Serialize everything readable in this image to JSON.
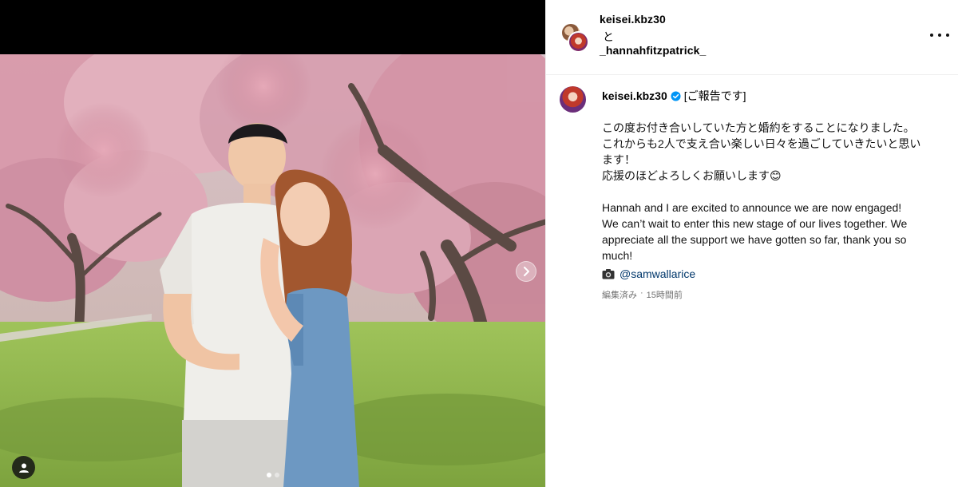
{
  "post": {
    "header": {
      "username": "keisei.kbz30",
      "connector": "と",
      "collaborator": "_hannahfitzpatrick_",
      "more_icon": "more-horizontal-icon"
    },
    "caption": {
      "username": "keisei.kbz30",
      "verified": true,
      "heading": "[ご報告です]",
      "japanese_lines": [
        "この度お付き合いしていた方と婚約をすることになりました。",
        "これからも2人で支え合い楽しい日々を過ごしていきたいと思い",
        "ます！",
        "応援のほどよろしくお願いします😊"
      ],
      "english_lines": [
        "Hannah and I are excited to announce we are now engaged!",
        "We can’t wait to enter this new stage of our lives together. We",
        "appreciate all the support we have gotten so far, thank you so",
        "much!"
      ],
      "credit_icon": "camera-icon",
      "credit": "@samwallarice",
      "edited": "編集済み",
      "separator": "·",
      "time": "15時間前"
    },
    "media": {
      "carousel_dots": 2,
      "active_dot": 0,
      "icons": [
        "user-tag-icon",
        "chevron-right-icon"
      ]
    }
  },
  "colors": {
    "link": "#00376b",
    "verified": "#0095f6",
    "meta": "#737373",
    "divider": "#efefef"
  }
}
